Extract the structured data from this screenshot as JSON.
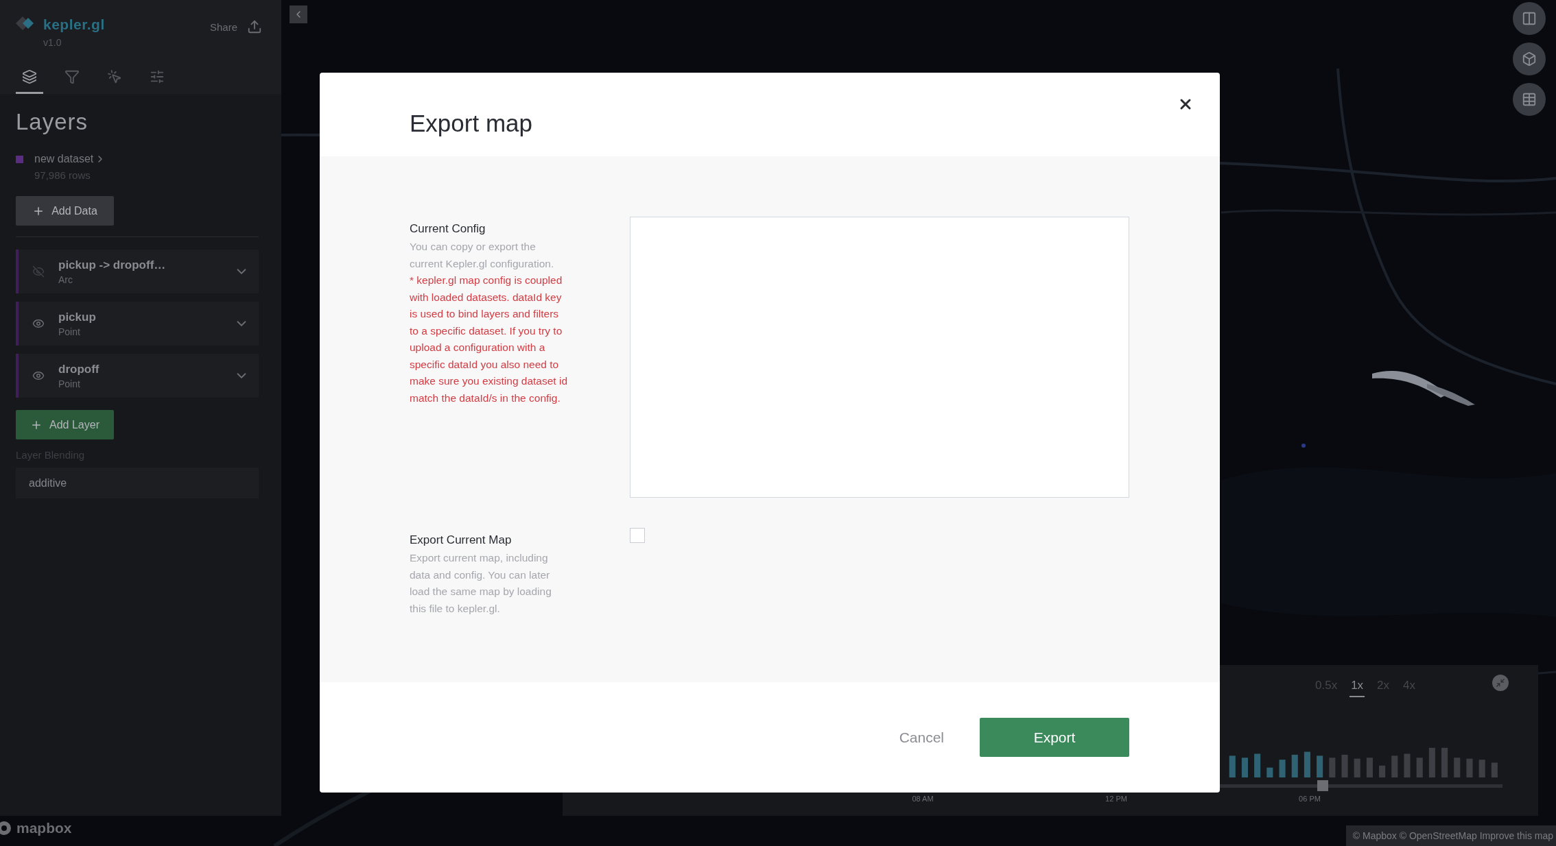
{
  "sidebar": {
    "logo": {
      "name": "kepler.gl",
      "version": "v1.0"
    },
    "share": "Share",
    "tabs": [
      {
        "kind": "layers",
        "selected": true
      },
      {
        "kind": "filters",
        "selected": false
      },
      {
        "kind": "interactions",
        "selected": false
      },
      {
        "kind": "settings",
        "selected": false
      }
    ],
    "title": "Layers",
    "dataset": {
      "name": "new dataset",
      "rows": "97,986 rows",
      "color": "#5a2d82"
    },
    "add_data": "Add Data",
    "layers": [
      {
        "name": "pickup -> dropoff…",
        "type": "Arc",
        "visible": false
      },
      {
        "name": "pickup",
        "type": "Point",
        "visible": true
      },
      {
        "name": "dropoff",
        "type": "Point",
        "visible": true
      }
    ],
    "add_layer": "Add Layer",
    "blending": {
      "label": "Layer Blending",
      "value": "additive"
    }
  },
  "modal": {
    "title": "Export map",
    "sections": [
      {
        "kind": "config",
        "title": "Current Config",
        "description": "You can copy or export the current Kepler.gl configuration.",
        "note": "* kepler.gl map config is coupled with loaded datasets. dataId key is used to bind layers and filters to a specific dataset. If you try to upload a configuration with a specific dataId you also need to make sure you existing dataset id match the dataId/s in the config."
      },
      {
        "kind": "checkbox",
        "title": "Export Current Map",
        "description": "Export current map, including data and config. You can later load the same map by loading this file to kepler.gl.",
        "checked": false
      }
    ],
    "cancel": "Cancel",
    "confirm": "Export"
  },
  "timeline": {
    "speeds": [
      {
        "label": "0.5x",
        "selected": false
      },
      {
        "label": "1x",
        "selected": true
      },
      {
        "label": "2x",
        "selected": false
      },
      {
        "label": "4x",
        "selected": false
      }
    ],
    "level": 0.8,
    "ticks": [
      "08 AM",
      "12 PM",
      "06 PM"
    ]
  },
  "map": {
    "logo": "mapbox",
    "attribution": "© Mapbox © OpenStreetMap Improve this map"
  }
}
